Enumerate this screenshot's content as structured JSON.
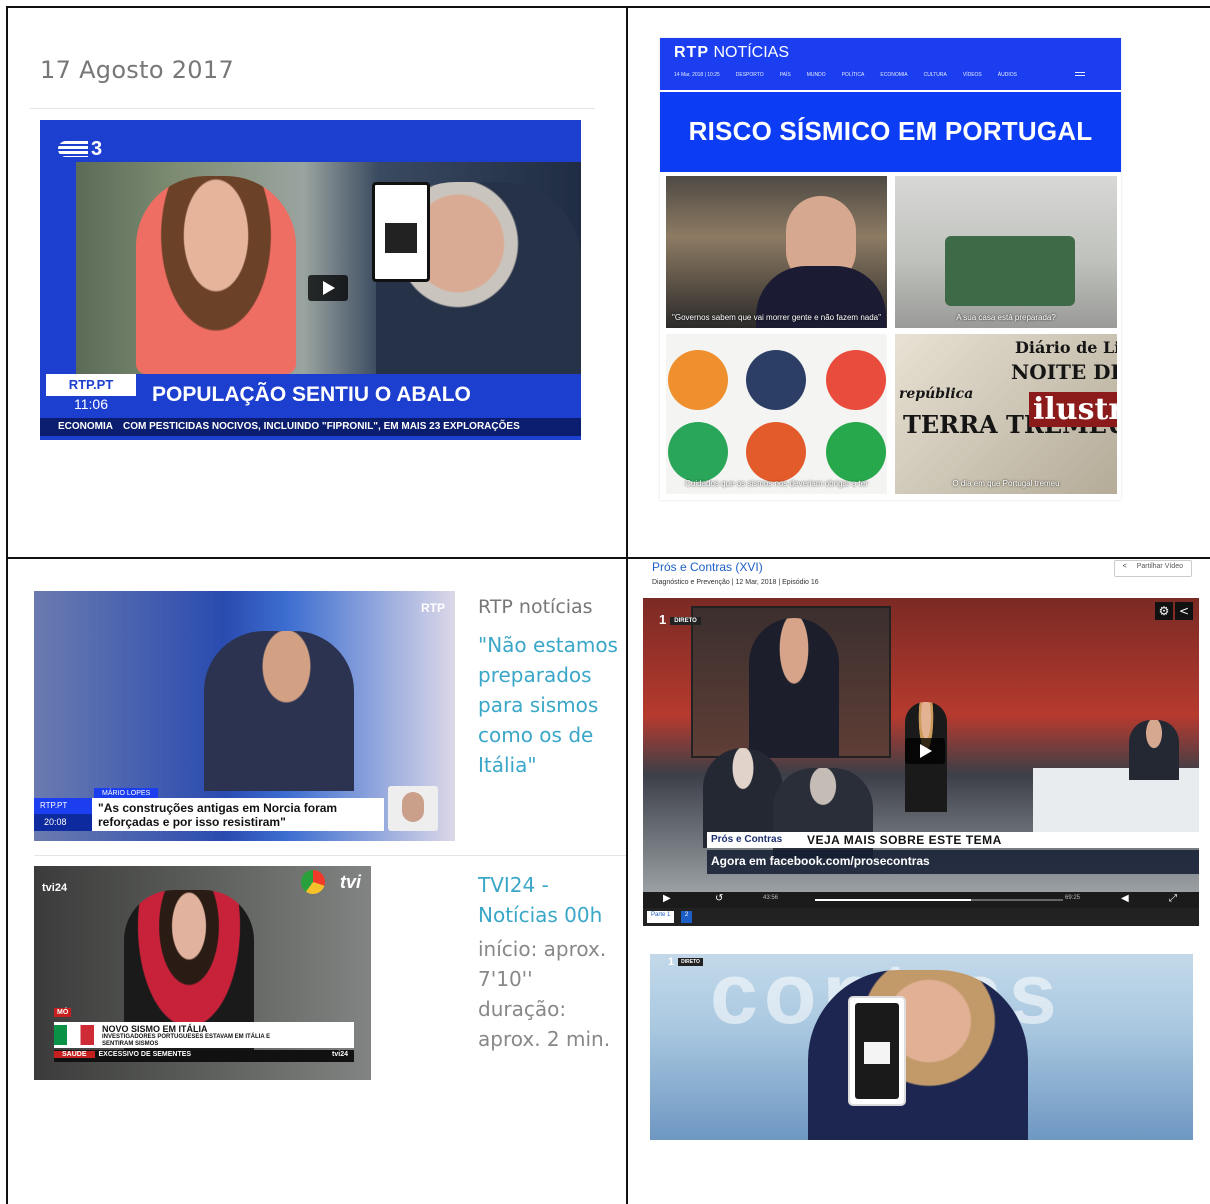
{
  "q1": {
    "date": "17 Agosto 2017",
    "video": {
      "channel": "3",
      "brand": "RTP.PT",
      "time": "11:06",
      "headline": "POPULAÇÃO SENTIU O ABALO",
      "ticker_tag": "ECONOMIA",
      "ticker_text": "COM PESTICIDAS NOCIVOS, INCLUINDO \"FIPRONIL\", EM MAIS 23 EXPLORAÇÕES"
    }
  },
  "q2": {
    "logo_bold": "RTP",
    "logo_rest": "NOTÍCIAS",
    "nav": [
      "14 Mar, 2018 | 10:25",
      "DESPORTO",
      "PAÍS",
      "MUNDO",
      "POLÍTICA",
      "ECONOMIA",
      "CULTURA",
      "VÍDEOS",
      "ÁUDIOS"
    ],
    "banner": "RISCO SÍSMICO EM PORTUGAL",
    "tiles": [
      {
        "caption": "\"Governos sabem que vai morrer gente e não fazem nada\""
      },
      {
        "caption": "A sua casa está preparada?"
      },
      {
        "caption": "Cuidados que os sismos nos deveriam obrigar a ter"
      },
      {
        "caption": "O dia em que Portugal tremeu"
      }
    ],
    "newspaper": {
      "masthead": "Diário de Lisboa",
      "headline1": "NOITE DE PÂ",
      "headline2": "TERRA TREMEU",
      "headline3": "ilustra",
      "headline4": "república"
    }
  },
  "q3": {
    "video1": {
      "logo": "RTP",
      "name_tag": "MÁRIO LOPES",
      "brand": "RTP.PT",
      "time": "20:08",
      "caption": "\"As construções antigas em Norcia foram reforçadas e por isso resistiram\""
    },
    "source1": {
      "label": "RTP notícias",
      "quote": "\"Não estamos preparados para sismos como os de Itália\""
    },
    "video2": {
      "logo": "tvi24",
      "tvi": "tvi",
      "mo": "MÓ",
      "headline": "NOVO SISMO EM ITÁLIA",
      "subline": "INVESTIGADORES PORTUGUESES ESTAVAM EM ITÁLIA E SENTIRAM SISMOS",
      "ticker_tag": "SAÚDE",
      "ticker_text": "EXCESSIVO DE SEMENTES",
      "ticker_brand": "tvi24"
    },
    "source2": {
      "title": "TVI24 - Notícias 00h",
      "start": "início: aprox. 7'10''",
      "duration": "duração: aprox. 2 min."
    }
  },
  "q4": {
    "player": {
      "title": "Prós e Contras (XVI)",
      "subtitle": "Diagnóstico e Prevenção | 12 Mar, 2018 | Episódio 16",
      "share": "Partilhar Vídeo",
      "channel": "1",
      "live": "DIRETO",
      "program": "Prós e Contras",
      "veja": "VEJA MAIS SOBRE ESTE TEMA",
      "facebook": "Agora em facebook.com/prosecontras",
      "time_current": "43:56",
      "time_total": "69:25",
      "progress": 0.63,
      "part1": "Parte 1",
      "part2": "2"
    },
    "video2": {
      "channel": "1",
      "live": "DIRETO",
      "bigtext": "contras"
    }
  },
  "colors": {
    "rtp_blue": "#1a3ef0",
    "link_teal": "#3aa7c8",
    "grey_text": "#777777"
  }
}
